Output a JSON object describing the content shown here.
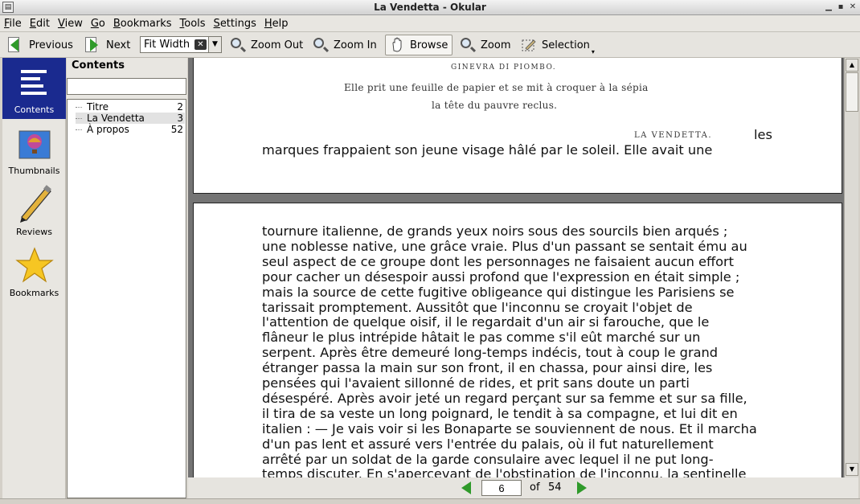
{
  "window": {
    "title": "La Vendetta - Okular"
  },
  "menu": [
    "File",
    "Edit",
    "View",
    "Go",
    "Bookmarks",
    "Tools",
    "Settings",
    "Help"
  ],
  "toolbar": {
    "previous": "Previous",
    "next": "Next",
    "zoom_value": "Fit Width",
    "zoom_out": "Zoom Out",
    "zoom_in": "Zoom In",
    "browse": "Browse",
    "zoom": "Zoom",
    "selection": "Selection"
  },
  "sidebar": [
    {
      "label": "Contents",
      "icon": "contents-icon",
      "selected": true
    },
    {
      "label": "Thumbnails",
      "icon": "thumbnails-icon"
    },
    {
      "label": "Reviews",
      "icon": "pencil-icon"
    },
    {
      "label": "Bookmarks",
      "icon": "star-icon"
    }
  ],
  "toc": {
    "header": "Contents",
    "search_value": "",
    "items": [
      {
        "title": "Titre",
        "page": "2"
      },
      {
        "title": "La Vendetta",
        "page": "3"
      },
      {
        "title": "À propos",
        "page": "52"
      }
    ]
  },
  "document": {
    "page1_scan_header": "GINEVRA DI PIOMBO.",
    "page1_caption_1": "Elle prit une feuille de papier et se mit à croquer à la sépia",
    "page1_caption_2": "la tête du pauvre reclus.",
    "page1_scan_footer": "LA VENDETTA.",
    "page1_line_end": "les",
    "page1_line_last": "marques frappaient son jeune visage hâlé par le soleil. Elle avait une",
    "page2_lines": [
      "tournure italienne, de grands yeux noirs sous des sourcils bien arqués ;",
      "une noblesse native, une grâce vraie. Plus d'un passant se sentait ému au",
      "seul aspect de ce groupe dont les personnages ne faisaient aucun effort",
      "pour cacher un désespoir aussi profond que l'expression en était simple ;",
      "mais la source de cette fugitive obligeance qui distingue les Parisiens se",
      "tarissait promptement. Aussitôt que l'inconnu se croyait l'objet de",
      "l'attention de quelque oisif, il le regardait d'un air si farouche, que le",
      "flâneur le plus intrépide hâtait le pas comme s'il eût marché sur un",
      "serpent. Après être demeuré long-temps indécis, tout à coup le grand",
      "étranger passa la main sur son front, il en chassa, pour ainsi dire, les",
      "pensées qui l'avaient sillonné de rides, et prit sans doute un parti",
      "désespéré. Après avoir jeté un regard perçant sur sa femme et sur sa fille,",
      "il tira de sa veste un long poignard, le tendit à sa compagne, et lui dit en",
      "italien : — Je vais voir si les Bonaparte se souviennent de nous. Et il marcha",
      "d'un pas lent et assuré vers l'entrée du palais, où il fut naturellement",
      "arrêté par un soldat de la garde consulaire avec lequel il ne put long-",
      "temps discuter. En s'apercevant de l'obstination de l'inconnu, la sentinelle"
    ]
  },
  "pager": {
    "current": "6",
    "of_label": "of",
    "total": "54"
  },
  "colors": {
    "sidebar_selected": "#1a2a8f",
    "nav_arrow": "#2f9a2a"
  }
}
